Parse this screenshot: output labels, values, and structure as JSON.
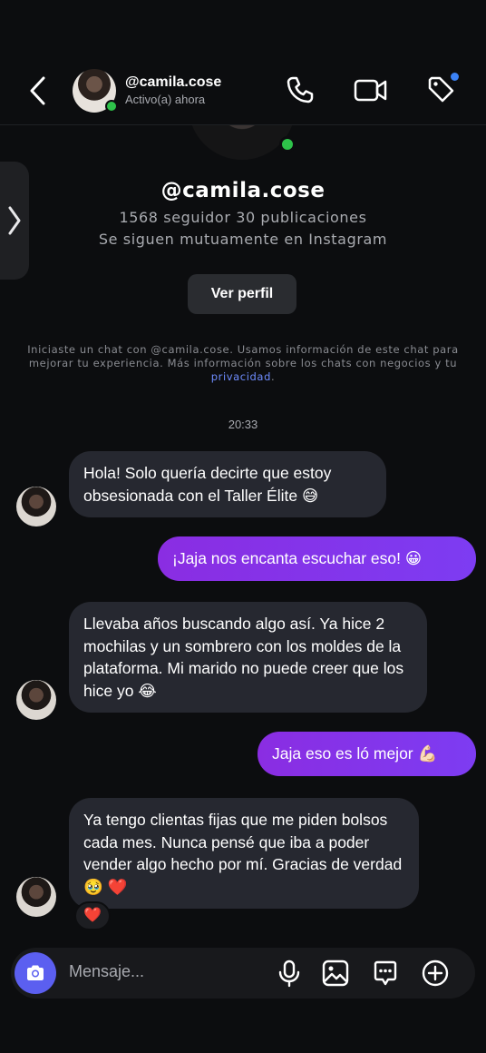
{
  "header": {
    "username": "@camila.cose",
    "status": "Activo(a) ahora"
  },
  "profile": {
    "username": "@camila.cose",
    "stats": "1568 seguidor 30 publicaciones",
    "mutual": "Se siguen mutuamente en Instagram",
    "view_profile_label": "Ver perfil"
  },
  "disclaimer": {
    "text": "Iniciaste un chat con @camila.cose. Usamos información de este chat para mejorar tu experiencia. Más información sobre los chats con negocios y tu",
    "link": "privacidad",
    "tail": "."
  },
  "timestamp": "20:33",
  "messages": [
    {
      "from": "them",
      "text": "Hola! Solo quería decirte que estoy obsesionada con el Taller Élite 😅"
    },
    {
      "from": "me",
      "text": "¡Jaja nos encanta escuchar eso! 😀"
    },
    {
      "from": "them",
      "text": "Llevaba años buscando algo así. Ya hice 2 mochilas y un sombrero con los moldes de la plataforma. Mi marido no puede creer que los hice yo 😂"
    },
    {
      "from": "me",
      "text": "Jaja eso es ló mejor 💪🏻"
    },
    {
      "from": "them",
      "text": "Ya tengo clientas fijas que me piden bolsos cada mes. Nunca pensé que iba a poder vender algo hecho por mí. Gracias de verdad 🥹 ❤️",
      "reaction": "❤️"
    }
  ],
  "composer": {
    "placeholder": "Mensaje..."
  },
  "colors": {
    "accent_purple": "#8a2de2",
    "online_green": "#2ec24a",
    "camera_button": "#5b5ff0",
    "link_blue": "#6f8dff"
  }
}
